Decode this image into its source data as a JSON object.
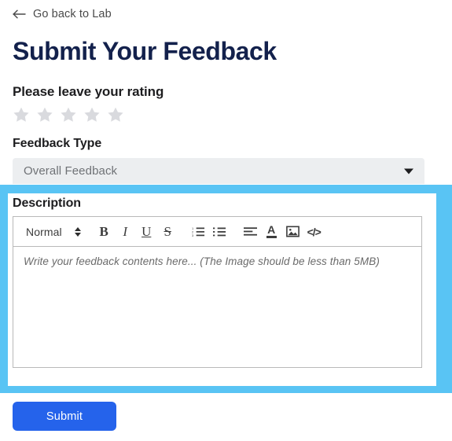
{
  "back_link": {
    "label": "Go back to Lab",
    "icon": "arrow-left-icon"
  },
  "page_title": "Submit Your Feedback",
  "rating": {
    "label": "Please leave your rating",
    "max": 5,
    "selected": 0,
    "star_icon": "star-icon",
    "empty_color": "#d9dade"
  },
  "feedback_type": {
    "label": "Feedback Type",
    "selected": "Overall Feedback",
    "caret_icon": "chevron-down-icon"
  },
  "description": {
    "label": "Description",
    "highlight_color": "#59c4f4",
    "editor": {
      "placeholder": "Write your feedback contents here... (The Image should be less than 5MB)",
      "value": "",
      "toolbar": {
        "format": {
          "label": "Normal",
          "icon": "updown-arrows-icon"
        },
        "buttons": [
          {
            "name": "bold-button",
            "glyph": "B",
            "icon": "bold-icon"
          },
          {
            "name": "italic-button",
            "glyph": "I",
            "icon": "italic-icon"
          },
          {
            "name": "underline-button",
            "glyph": "U",
            "icon": "underline-icon"
          },
          {
            "name": "strikethrough-button",
            "glyph": "S",
            "icon": "strikethrough-icon"
          },
          {
            "name": "ordered-list-button",
            "glyph": "",
            "icon": "ordered-list-icon"
          },
          {
            "name": "bullet-list-button",
            "glyph": "",
            "icon": "bullet-list-icon"
          },
          {
            "name": "align-button",
            "glyph": "",
            "icon": "align-left-icon"
          },
          {
            "name": "text-color-button",
            "glyph": "A",
            "icon": "text-color-icon"
          },
          {
            "name": "insert-image-button",
            "glyph": "",
            "icon": "image-icon"
          },
          {
            "name": "code-block-button",
            "glyph": "</>",
            "icon": "code-icon"
          }
        ]
      }
    }
  },
  "submit": {
    "label": "Submit",
    "color": "#2563eb"
  }
}
